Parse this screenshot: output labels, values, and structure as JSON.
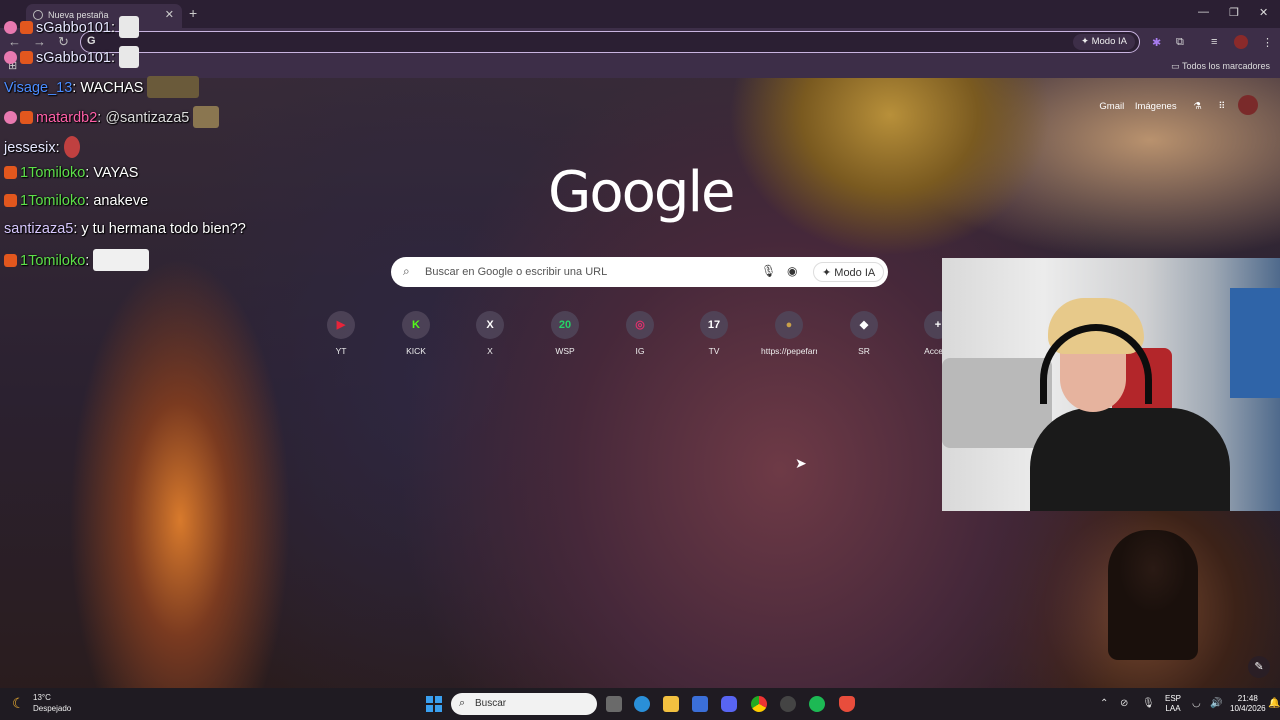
{
  "browser": {
    "tab_title": "Nueva pestaña",
    "omnibox_mode_label": "Modo IA",
    "bookmarks_label": "Todos los marcadores"
  },
  "chat": [
    {
      "user": "sGabbo101",
      "text": ":",
      "user_color": "#ffffff"
    },
    {
      "user": "sGabbo101",
      "text": ":",
      "user_color": "#ffffff"
    },
    {
      "user": "Visage_13",
      "text": ": WACHAS",
      "user_color": "#4b8cff"
    },
    {
      "user": "matardb2",
      "text": ": @santizaza5",
      "user_color": "#ff5fa8"
    },
    {
      "user": "jessesix",
      "text": ":",
      "user_color": "#e6e6ff"
    },
    {
      "user": "1Tomiloko",
      "text": ": VAYAS",
      "user_color": "#5ee04a"
    },
    {
      "user": "1Tomiloko",
      "text": ": anakeve",
      "user_color": "#5ee04a"
    },
    {
      "user": "santizaza5",
      "text": ": y tu hermana todo bien??",
      "user_color": "#d8c8ff"
    },
    {
      "user": "1Tomiloko",
      "text": ":",
      "user_color": "#5ee04a"
    }
  ],
  "google": {
    "logo": "Google",
    "top_links": [
      "Gmail",
      "Imágenes"
    ],
    "search_placeholder": "Buscar en Google o escribir una URL",
    "ai_mode": "Modo IA",
    "shortcuts": [
      {
        "label": "YT",
        "glyph": "▶",
        "color": "#e8243a"
      },
      {
        "label": "KICK",
        "glyph": "K",
        "color": "#53fc18"
      },
      {
        "label": "X",
        "glyph": "X",
        "color": "#ffffff"
      },
      {
        "label": "WSP",
        "glyph": "20",
        "color": "#25d366"
      },
      {
        "label": "IG",
        "glyph": "◎",
        "color": "#e1306c"
      },
      {
        "label": "TV",
        "glyph": "17",
        "color": "#ffffff"
      },
      {
        "label": "https://pepefarm...",
        "glyph": "●",
        "color": "#c8a04a"
      },
      {
        "label": "SR",
        "glyph": "◆",
        "color": "#ffffff"
      },
      {
        "label": "Acceso",
        "glyph": "+",
        "color": "#ffffff"
      }
    ]
  },
  "taskbar": {
    "weather_temp": "13°C",
    "weather_desc": "Despejado",
    "search_placeholder": "Buscar",
    "lang_line1": "ESP",
    "lang_line2": "LAA",
    "time": "21:48",
    "date": "10/4/2026",
    "app_icons": [
      "file-explorer-icon",
      "edge-icon",
      "folder-icon",
      "store-icon",
      "discord-icon",
      "chrome-icon",
      "obs-icon",
      "spotify-icon",
      "brave-icon"
    ]
  }
}
